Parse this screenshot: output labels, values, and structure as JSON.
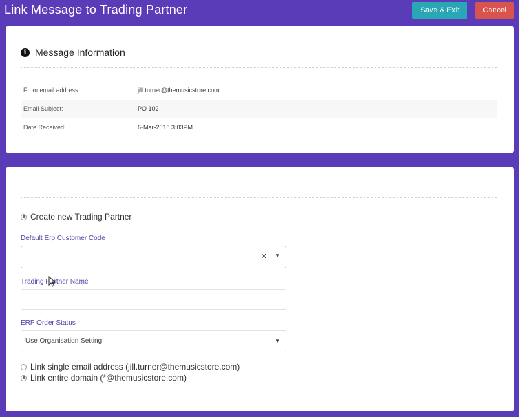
{
  "header": {
    "title": "Link Message to Trading Partner",
    "save_label": "Save & Exit",
    "cancel_label": "Cancel"
  },
  "message_info": {
    "title": "Message Information",
    "rows": [
      {
        "label": "From email address:",
        "value": "jill.turner@themusicstore.com"
      },
      {
        "label": "Email Subject:",
        "value": "PO 102"
      },
      {
        "label": "Date Received:",
        "value": "6-Mar-2018 3:03PM"
      }
    ]
  },
  "form": {
    "create_new_label": "Create new Trading Partner",
    "erp_code_label": "Default Erp Customer Code",
    "erp_code_value": "",
    "partner_name_label": "Trading Partner Name",
    "partner_name_value": "",
    "order_status_label": "ERP Order Status",
    "order_status_value": "Use Organisation Setting",
    "link_single_label": "Link single email address (jill.turner@themusicstore.com)",
    "link_domain_label": "Link entire domain (*@themusicstore.com)"
  },
  "colors": {
    "background": "#5b3cb8",
    "save_button": "#2aa7b4",
    "cancel_button": "#d9534f",
    "field_label": "#4a3fa0"
  }
}
